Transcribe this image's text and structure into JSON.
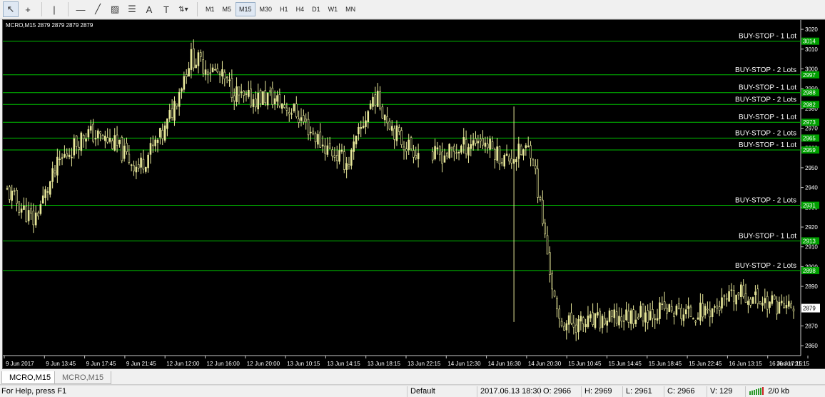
{
  "toolbar": {
    "tools": [
      {
        "name": "cursor-icon",
        "glyph": "↖"
      },
      {
        "name": "crosshair-icon",
        "glyph": "+"
      },
      {
        "name": "vertical-line-icon",
        "glyph": "|"
      },
      {
        "name": "horizontal-line-icon",
        "glyph": "—"
      },
      {
        "name": "trendline-icon",
        "glyph": "╱"
      },
      {
        "name": "equidistant-channel-icon",
        "glyph": "▨"
      },
      {
        "name": "fibonacci-icon",
        "glyph": "☰"
      },
      {
        "name": "text-icon",
        "glyph": "A"
      },
      {
        "name": "text-label-icon",
        "glyph": "T"
      },
      {
        "name": "arrows-menu-icon",
        "glyph": "⇅▾"
      }
    ],
    "timeframes": [
      "M1",
      "M5",
      "M15",
      "M30",
      "H1",
      "H4",
      "D1",
      "W1",
      "MN"
    ],
    "active_timeframe": "M15"
  },
  "chart": {
    "header": "MCRO,M15  2879 2879 2879 2879",
    "background": "#000000",
    "candle_color": "#e8e89a",
    "line_color": "#00c000",
    "label_bg": "#00a000",
    "current_price_label": "2879",
    "price_ticks": [
      "3020",
      "3010",
      "3000",
      "2990",
      "2980",
      "2970",
      "2960",
      "2950",
      "2940",
      "2930",
      "2920",
      "2910",
      "2900",
      "2890",
      "2880",
      "2870",
      "2860"
    ],
    "time_ticks": [
      "9 Jun 2017",
      "9 Jun 13:45",
      "9 Jun 17:45",
      "9 Jun 21:45",
      "12 Jun 12:00",
      "12 Jun 16:00",
      "12 Jun 20:00",
      "13 Jun 10:15",
      "13 Jun 14:15",
      "13 Jun 18:15",
      "13 Jun 22:15",
      "14 Jun 12:30",
      "14 Jun 16:30",
      "14 Jun 20:30",
      "15 Jun 10:45",
      "15 Jun 14:45",
      "15 Jun 18:45",
      "15 Jun 22:45",
      "16 Jun 13:15",
      "16 Jun 17:15",
      "16 Jun 21:15"
    ],
    "orders": [
      {
        "label": "BUY-STOP - 1 Lot",
        "price": "3014"
      },
      {
        "label": "BUY-STOP - 2 Lots",
        "price": "2997"
      },
      {
        "label": "BUY-STOP - 1 Lot",
        "price": "2988"
      },
      {
        "label": "BUY-STOP - 2 Lots",
        "price": "2982"
      },
      {
        "label": "BUY-STOP - 1 Lot",
        "price": "2973"
      },
      {
        "label": "BUY-STOP - 2 Lots",
        "price": "2965"
      },
      {
        "label": "BUY-STOP - 1 Lot",
        "price": "2959"
      },
      {
        "label": "BUY-STOP - 2 Lots",
        "price": "2931"
      },
      {
        "label": "BUY-STOP - 1 Lot",
        "price": "2913"
      },
      {
        "label": "BUY-STOP - 2 Lots",
        "price": "2898"
      }
    ]
  },
  "chart_data": {
    "type": "candlestick",
    "symbol": "MCRO",
    "timeframe": "M15",
    "ylim": [
      2855,
      3024
    ],
    "x": [
      "9 Jun 2017",
      "9 Jun 13:45",
      "9 Jun 17:45",
      "9 Jun 21:45",
      "12 Jun 12:00",
      "12 Jun 16:00",
      "12 Jun 20:00",
      "13 Jun 10:15",
      "13 Jun 14:15",
      "13 Jun 18:15",
      "13 Jun 22:15",
      "14 Jun 12:30",
      "14 Jun 16:30",
      "14 Jun 20:30",
      "15 Jun 10:45",
      "15 Jun 14:45",
      "15 Jun 18:45",
      "15 Jun 22:45",
      "16 Jun 13:15",
      "16 Jun 17:15",
      "16 Jun 21:15"
    ],
    "series": [
      {
        "values": [
          2938,
          2923,
          2953,
          2968,
          2963,
          2950,
          2968,
          3006,
          2998,
          2984,
          2986,
          2978,
          2962,
          2952,
          2987,
          2964,
          2955,
          2958,
          2965,
          2954,
          2960,
          2872,
          2871,
          2873,
          2876,
          2878,
          2876,
          2879,
          2886,
          2882,
          2879
        ]
      }
    ],
    "horizontal_levels": [
      3014,
      2997,
      2988,
      2982,
      2973,
      2965,
      2959,
      2931,
      2913,
      2898
    ],
    "last_price": 2879
  },
  "tabs": [
    "MCRO,M15",
    "MCRO,M15"
  ],
  "status": {
    "help": "For Help, press F1",
    "profile": "Default",
    "datetime": "2017.06.13 18:30",
    "open": "O: 2966",
    "high": "H: 2969",
    "low": "L: 2961",
    "close": "C: 2966",
    "volume": "V: 129",
    "traffic": "2/0 kb"
  }
}
